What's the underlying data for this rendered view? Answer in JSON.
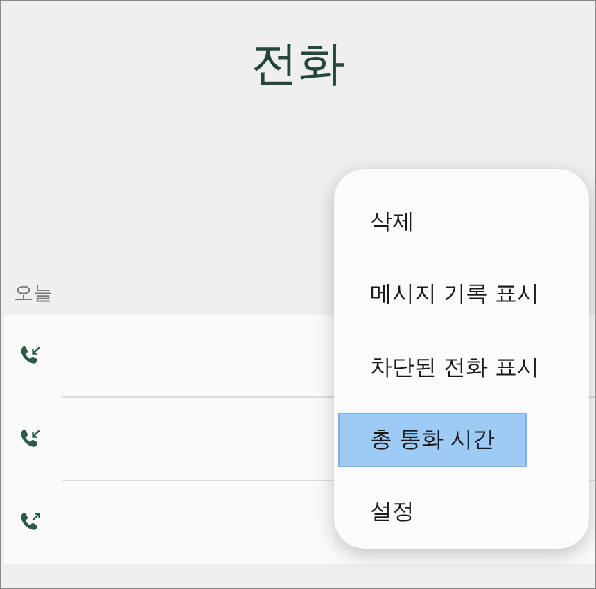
{
  "header": {
    "title": "전화"
  },
  "section": {
    "label": "오늘"
  },
  "calls": [
    {
      "kind": "incoming"
    },
    {
      "kind": "incoming"
    },
    {
      "kind": "outgoing"
    }
  ],
  "menu": [
    {
      "label": "삭제",
      "selected": false
    },
    {
      "label": "메시지 기록 표시",
      "selected": false
    },
    {
      "label": "차단된 전화 표시",
      "selected": false
    },
    {
      "label": "총 통화 시간",
      "selected": true
    },
    {
      "label": "설정",
      "selected": false
    }
  ]
}
